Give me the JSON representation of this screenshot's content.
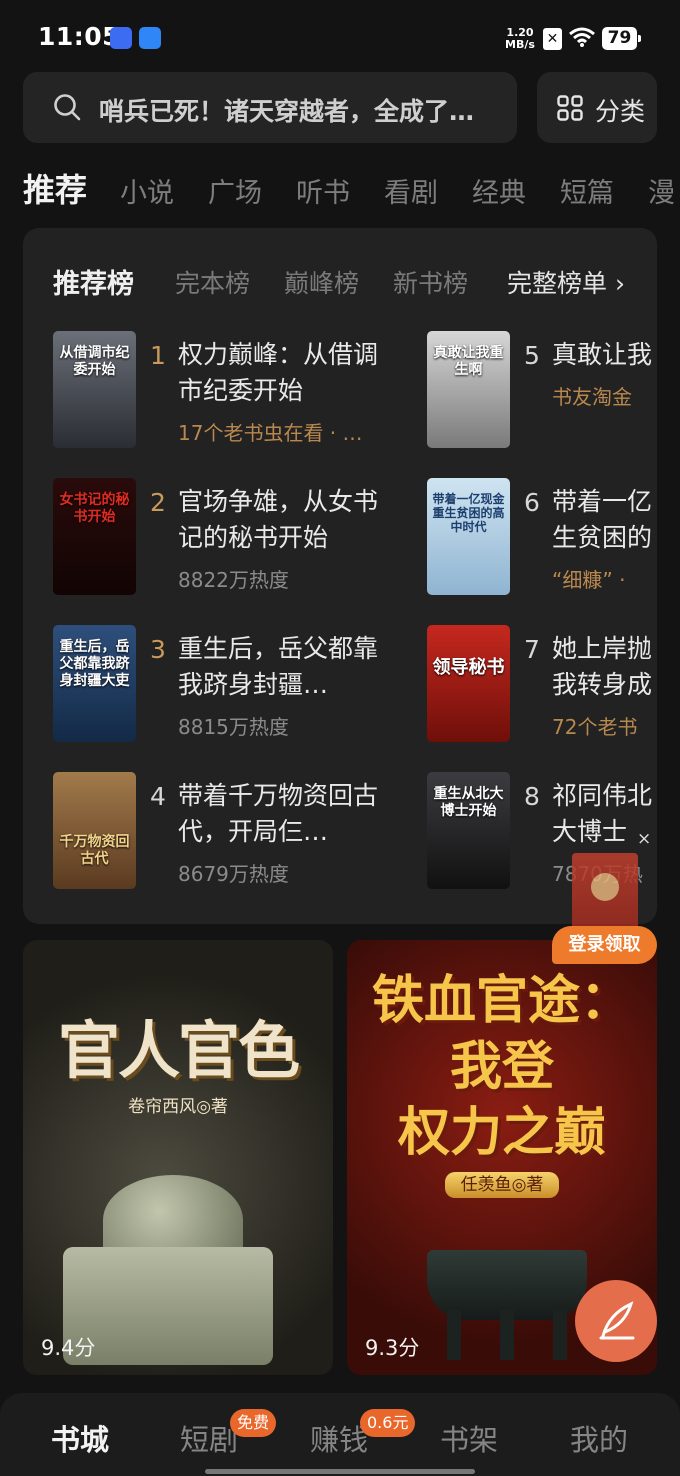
{
  "status_bar": {
    "time": "11:05",
    "network_speed": "1.20\nMB/s",
    "battery": "79",
    "icons": [
      "vivo-app-icon",
      "app-icon",
      "sim-off-icon",
      "wifi-icon",
      "battery-icon"
    ]
  },
  "search": {
    "placeholder": "哨兵已死！诸天穿越者，全成了…",
    "icon": "search-icon"
  },
  "category_button": {
    "label": "分类",
    "icon": "grid-icon"
  },
  "channel_tabs": [
    "推荐",
    "小说",
    "广场",
    "听书",
    "看剧",
    "经典",
    "短篇",
    "漫"
  ],
  "ranking": {
    "tabs": [
      "推荐榜",
      "完本榜",
      "巅峰榜",
      "新书榜"
    ],
    "full_list_label": "完整榜单 ›",
    "books": [
      {
        "rank": "1",
        "title": "权力巅峰：从借调市纪委开始",
        "meta": "17个老书虫在看 · …",
        "cover_text": "从借调市纪委开始"
      },
      {
        "rank": "2",
        "title": "官场争雄，从女书记的秘书开始",
        "meta": "8822万热度",
        "cover_text": "女书记的秘书开始"
      },
      {
        "rank": "3",
        "title": "重生后，岳父都靠我跻身封疆…",
        "meta": "8815万热度",
        "cover_text": "重生后，岳父都靠我跻身封疆大吏"
      },
      {
        "rank": "4",
        "title": "带着千万物资回古代，开局仨…",
        "meta": "8679万热度",
        "cover_text": "千万物资回古代"
      },
      {
        "rank": "5",
        "title": "真敢让我",
        "meta": "书友淘金",
        "cover_text": "真敢让我重生啊"
      },
      {
        "rank": "6",
        "title": "带着一亿生贫困的",
        "meta": "“细糠” ·",
        "cover_text": "带着一亿现金重生贫困的高中时代"
      },
      {
        "rank": "7",
        "title": "她上岸抛我转身成",
        "meta": "72个老书",
        "cover_text": "领导秘书"
      },
      {
        "rank": "8",
        "title": "祁同伟北大博士",
        "meta": "7870万热",
        "cover_text": "重生从北大博士开始"
      }
    ]
  },
  "floating": {
    "close": "×",
    "login_label": "登录领取"
  },
  "featured": [
    {
      "title": "官人官色",
      "author": "卷帘西风◎著",
      "score": "9.4分"
    },
    {
      "title": "铁血官途：我登权力之巅",
      "title_lines": [
        "铁血官途：",
        "我登",
        "权力之巅"
      ],
      "author": "任羡鱼◎著",
      "score": "9.3分"
    }
  ],
  "bottom_nav": {
    "items": [
      "书城",
      "短剧",
      "赚钱",
      "书架",
      "我的"
    ],
    "badge_free": "免费",
    "badge_money": "0.6元"
  },
  "colors": {
    "background": "#131313",
    "card": "#222222",
    "accent_orange": "#ee7a2c",
    "gold_text": "#b9884e"
  }
}
